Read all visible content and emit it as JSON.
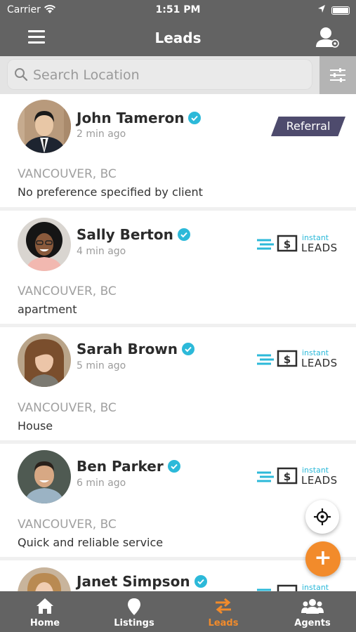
{
  "status_bar": {
    "carrier": "Carrier",
    "time": "1:51 PM"
  },
  "header": {
    "title": "Leads"
  },
  "search": {
    "placeholder": "Search Location"
  },
  "colors": {
    "bar": "#636363",
    "accent": "#f28b2b",
    "verified": "#2cb9d9",
    "referral": "#4e4b6d"
  },
  "leads": [
    {
      "name": "John Tameron",
      "time": "2 min ago",
      "city": "VANCOUVER, BC",
      "note": "No preference specified by client",
      "badge": "referral",
      "badge_label": "Referral"
    },
    {
      "name": "Sally Berton",
      "time": "4 min ago",
      "city": "VANCOUVER, BC",
      "note": "apartment",
      "badge": "instant-leads"
    },
    {
      "name": "Sarah Brown",
      "time": "5 min ago",
      "city": "VANCOUVER, BC",
      "note": "House",
      "badge": "instant-leads"
    },
    {
      "name": "Ben Parker",
      "time": "6 min ago",
      "city": "VANCOUVER, BC",
      "note": "Quick and reliable service",
      "badge": "instant-leads"
    },
    {
      "name": "Janet Simpson",
      "badge": "instant-leads"
    }
  ],
  "instant_leads": {
    "small": "instant",
    "big": "LEADS"
  },
  "tabs": [
    {
      "label": "Home",
      "icon": "home-icon"
    },
    {
      "label": "Listings",
      "icon": "map-pin-icon"
    },
    {
      "label": "Leads",
      "icon": "swap-arrows-icon",
      "active": true
    },
    {
      "label": "Agents",
      "icon": "group-icon"
    }
  ]
}
